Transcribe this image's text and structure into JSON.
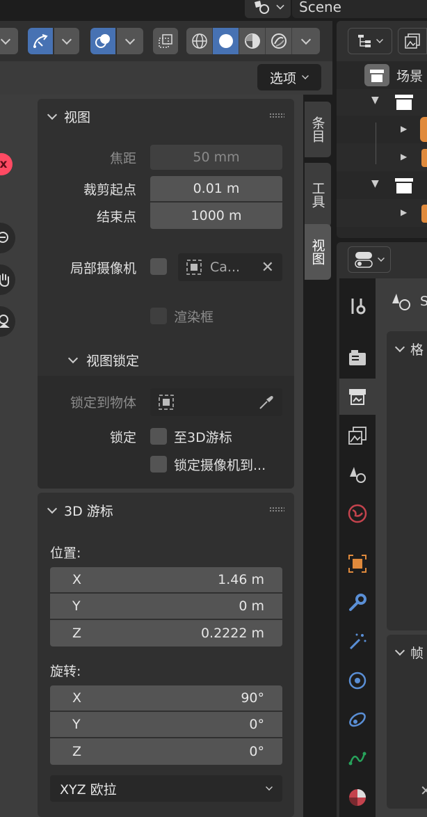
{
  "header": {
    "scene_label": "Scene",
    "options_label": "选项"
  },
  "side_tabs": {
    "item": "条目",
    "tool": "工具",
    "view": "视图"
  },
  "view_panel": {
    "title": "视图",
    "focal_label": "焦距",
    "focal_value": "50 mm",
    "clip_start_label": "裁剪起点",
    "clip_start_value": "0.01 m",
    "clip_end_label": "结束点",
    "clip_end_value": "1000 m",
    "local_camera_label": "局部摄像机",
    "camera_value": "Ca...",
    "render_region_label": "渲染框",
    "view_lock_title": "视图锁定",
    "lock_object_label": "锁定到物体",
    "lock_label": "锁定",
    "lock_cursor_label": "至3D游标",
    "lock_camera_label": "锁定摄像机到..."
  },
  "cursor_panel": {
    "title": "3D 游标",
    "location_label": "位置:",
    "location": [
      {
        "axis": "X",
        "value": "1.46 m"
      },
      {
        "axis": "Y",
        "value": "0 m"
      },
      {
        "axis": "Z",
        "value": "0.2222 m"
      }
    ],
    "rotation_label": "旋转:",
    "rotation": [
      {
        "axis": "X",
        "value": "90°"
      },
      {
        "axis": "Y",
        "value": "0°"
      },
      {
        "axis": "Z",
        "value": "0°"
      }
    ],
    "rotation_mode": "XYZ 欧拉"
  },
  "outliner": {
    "scene_collection_label": "场景"
  },
  "properties": {
    "scene_name_fragment": "S",
    "section1_fragment": "格",
    "section2_fragment": "帧"
  },
  "colors": {
    "accent_blue": "#4772b3",
    "panel_bg": "#303030",
    "field_bg": "#545454",
    "object_orange": "#e08a3c",
    "world_red": "#c4434d",
    "modifier_blue": "#5a8fd6",
    "constraint_green": "#27a35b"
  }
}
